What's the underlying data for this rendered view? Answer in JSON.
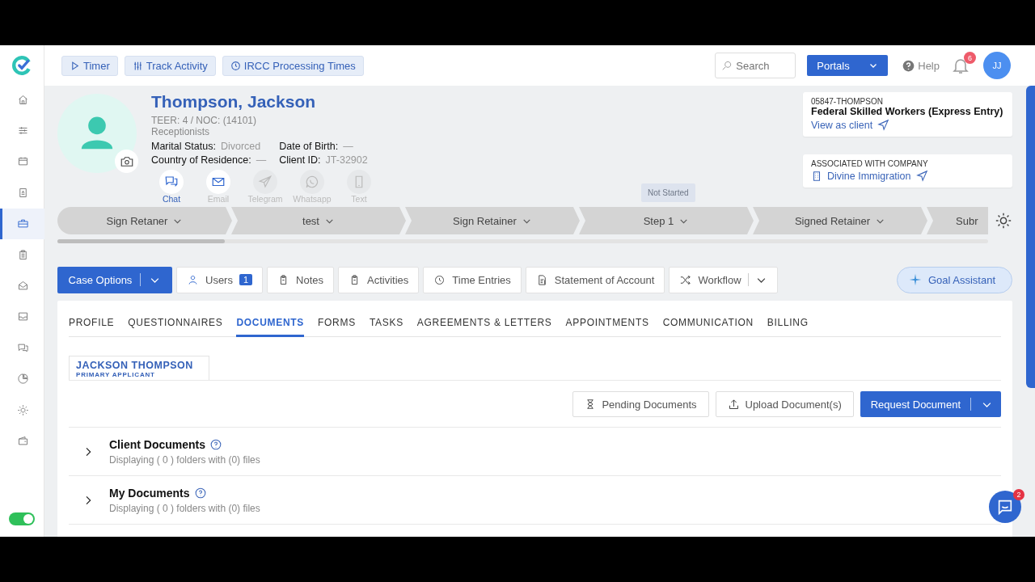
{
  "sidebar": {
    "items": [
      {
        "selected": false
      },
      {
        "selected": false
      },
      {
        "selected": false
      },
      {
        "selected": false
      },
      {
        "selected": true
      },
      {
        "selected": false
      },
      {
        "selected": false
      },
      {
        "selected": false
      },
      {
        "selected": false
      },
      {
        "selected": false
      },
      {
        "selected": false
      },
      {
        "selected": false
      }
    ],
    "toggle": {
      "on": true
    }
  },
  "topbar": {
    "buttons": [
      "Timer",
      "Track Activity",
      "IRCC Processing Times"
    ],
    "search": {
      "placeholder": "Search"
    },
    "portals": "Portals",
    "help": "Help",
    "notifications": "6",
    "avatar": "JJ"
  },
  "client": {
    "name": "Thompson, Jackson",
    "teer": "TEER: 4 / NOC: (14101)",
    "occupation": "Receptionists",
    "fields": [
      {
        "label": "Marital Status:",
        "value": "Divorced"
      },
      {
        "label": "Date of Birth:",
        "value": "—"
      },
      {
        "label": "Country of Residence:",
        "value": "—"
      },
      {
        "label": "Client ID:",
        "value": "JT-32902"
      }
    ],
    "channels": [
      {
        "label": "Chat",
        "enabled": true,
        "selected": true
      },
      {
        "label": "Email",
        "enabled": true,
        "selected": false
      },
      {
        "label": "Telegram",
        "enabled": false,
        "selected": false
      },
      {
        "label": "Whatsapp",
        "enabled": false,
        "selected": false
      },
      {
        "label": "Text",
        "enabled": false,
        "selected": false
      }
    ]
  },
  "case_card": {
    "file_number": "05847-THOMPSON",
    "program": "Federal Skilled Workers (Express Entry)",
    "link": "View as client"
  },
  "company_card": {
    "heading": "ASSOCIATED WITH COMPANY",
    "company": "Divine Immigration"
  },
  "stages": {
    "tooltip": "Not Started",
    "items": [
      "Sign Retaner",
      "test",
      "Sign Retainer",
      "Step 1",
      "Signed Retainer",
      "Subr"
    ]
  },
  "toolbar": {
    "case_options": "Case Options",
    "buttons": [
      {
        "label": "Users",
        "badge": "1"
      },
      {
        "label": "Notes"
      },
      {
        "label": "Activities"
      },
      {
        "label": "Time Entries"
      },
      {
        "label": "Statement of Account"
      }
    ],
    "workflow": "Workflow",
    "goal_assistant": "Goal Assistant"
  },
  "tabs": [
    {
      "label": "PROFILE",
      "selected": false
    },
    {
      "label": "QUESTIONNAIRES",
      "selected": false
    },
    {
      "label": "DOCUMENTS",
      "selected": true
    },
    {
      "label": "FORMS",
      "selected": false
    },
    {
      "label": "TASKS",
      "selected": false
    },
    {
      "label": "AGREEMENTS & LETTERS",
      "selected": false
    },
    {
      "label": "APPOINTMENTS",
      "selected": false
    },
    {
      "label": "COMMUNICATION",
      "selected": false
    },
    {
      "label": "BILLING",
      "selected": false
    }
  ],
  "applicant": {
    "name": "JACKSON THOMPSON",
    "role": "PRIMARY APPLICANT",
    "selected": true
  },
  "actions": {
    "pending": "Pending Documents",
    "upload": "Upload Document(s)",
    "request": "Request Document"
  },
  "sections": [
    {
      "title": "Client Documents",
      "summary": "Displaying ( 0 ) folders with (0) files",
      "expanded": false
    },
    {
      "title": "My Documents",
      "summary": "Displaying ( 0 ) folders with (0) files",
      "expanded": false
    }
  ],
  "chat_widget": {
    "badge": "2"
  }
}
